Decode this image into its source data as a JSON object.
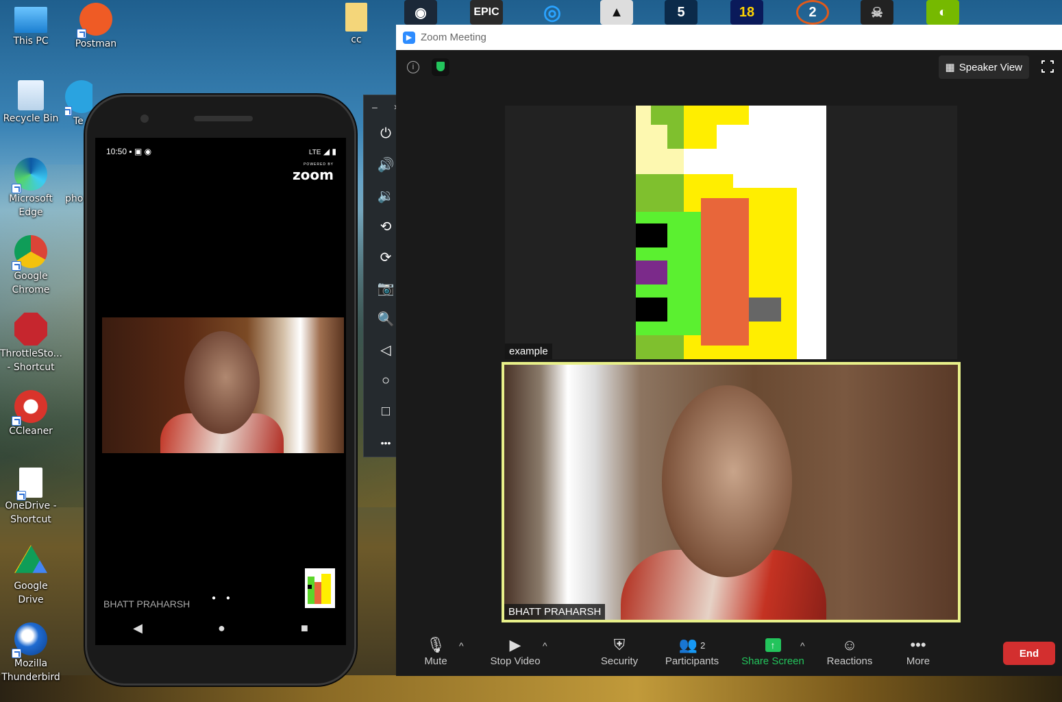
{
  "desktop": {
    "icons": [
      {
        "label": "This PC"
      },
      {
        "label": "Postman"
      },
      {
        "label": "cc"
      },
      {
        "label": "Recycle Bin"
      },
      {
        "label": "Te"
      },
      {
        "label": "Microsoft Edge"
      },
      {
        "label": "pho"
      },
      {
        "label": "Google Chrome"
      },
      {
        "label": "ThrottleSto... - Shortcut"
      },
      {
        "label": "CCleaner"
      },
      {
        "label": "OneDrive - Shortcut"
      },
      {
        "label": "Google Drive"
      },
      {
        "label": "Mozilla Thunderbird"
      }
    ],
    "top_icons": [
      {
        "label": ""
      },
      {
        "label": "EPIC"
      },
      {
        "label": ""
      },
      {
        "label": ""
      },
      {
        "label": "5"
      },
      {
        "label": "18"
      },
      {
        "label": "2"
      },
      {
        "label": ""
      },
      {
        "label": ""
      }
    ]
  },
  "phone": {
    "time": "10:50",
    "network": "LTE",
    "powered_by": "POWERED BY",
    "logo": "zoom",
    "participant_name": "BHATT PRAHARSH",
    "nav": {
      "back": "◀",
      "home": "●",
      "recents": "■"
    }
  },
  "emulator_toolbar": {
    "minimize": "–",
    "close": "×",
    "buttons": [
      {
        "name": "power-icon",
        "glyph": "⏻"
      },
      {
        "name": "volume-up-icon",
        "glyph": "🔊"
      },
      {
        "name": "volume-down-icon",
        "glyph": "🔉"
      },
      {
        "name": "rotate-left-icon",
        "glyph": "⟲"
      },
      {
        "name": "rotate-right-icon",
        "glyph": "⟳"
      },
      {
        "name": "camera-icon",
        "glyph": "📷"
      },
      {
        "name": "zoom-icon",
        "glyph": "🔍"
      },
      {
        "name": "back-icon",
        "glyph": "◁"
      },
      {
        "name": "home-icon",
        "glyph": "○"
      },
      {
        "name": "overview-icon",
        "glyph": "□"
      },
      {
        "name": "more-icon",
        "glyph": "•••"
      }
    ]
  },
  "zoom": {
    "window_title": "Zoom Meeting",
    "view_mode": "Speaker View",
    "share_tile_label": "example",
    "main_video_label": "BHATT PRAHARSH",
    "toolbar": {
      "mute": "Mute",
      "stop_video": "Stop Video",
      "security": "Security",
      "participants": "Participants",
      "participants_count": "2",
      "share_screen": "Share Screen",
      "reactions": "Reactions",
      "more": "More",
      "end": "End"
    },
    "colors": {
      "share_green": "#23c45c",
      "end_red": "#d32f2f",
      "active_border": "#e8f08a"
    }
  }
}
